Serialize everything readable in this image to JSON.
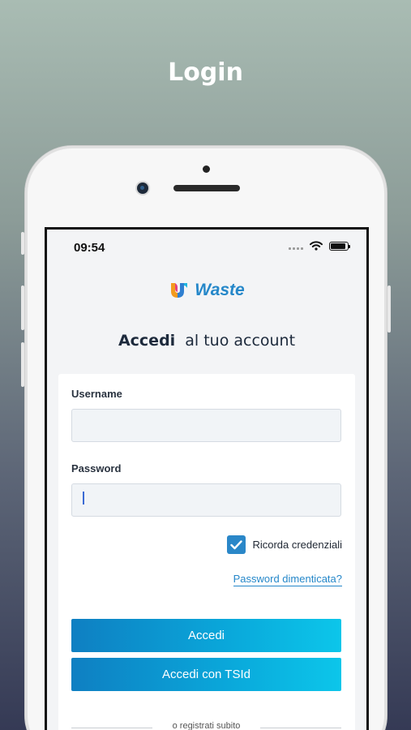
{
  "promo": {
    "title": "Login"
  },
  "status_bar": {
    "time": "09:54",
    "battery_level": 0.9
  },
  "app": {
    "logo_text": "Waste",
    "brand_color": "#2587c9"
  },
  "login": {
    "heading_strong": "Accedi",
    "heading_rest": "al tuo account",
    "username_label": "Username",
    "username_value": "",
    "password_label": "Password",
    "password_value": "",
    "remember_label": "Ricorda credenziali",
    "remember_checked": true,
    "forgot_password": "Password dimenticata?",
    "login_button": "Accedi",
    "login_tsid_button": "Accedi con TSId",
    "register_divider": "o registrati subito"
  },
  "icons": [
    "front-camera-icon",
    "signal-icon",
    "wifi-icon",
    "battery-icon",
    "waste-logo-icon",
    "checkmark-icon"
  ]
}
